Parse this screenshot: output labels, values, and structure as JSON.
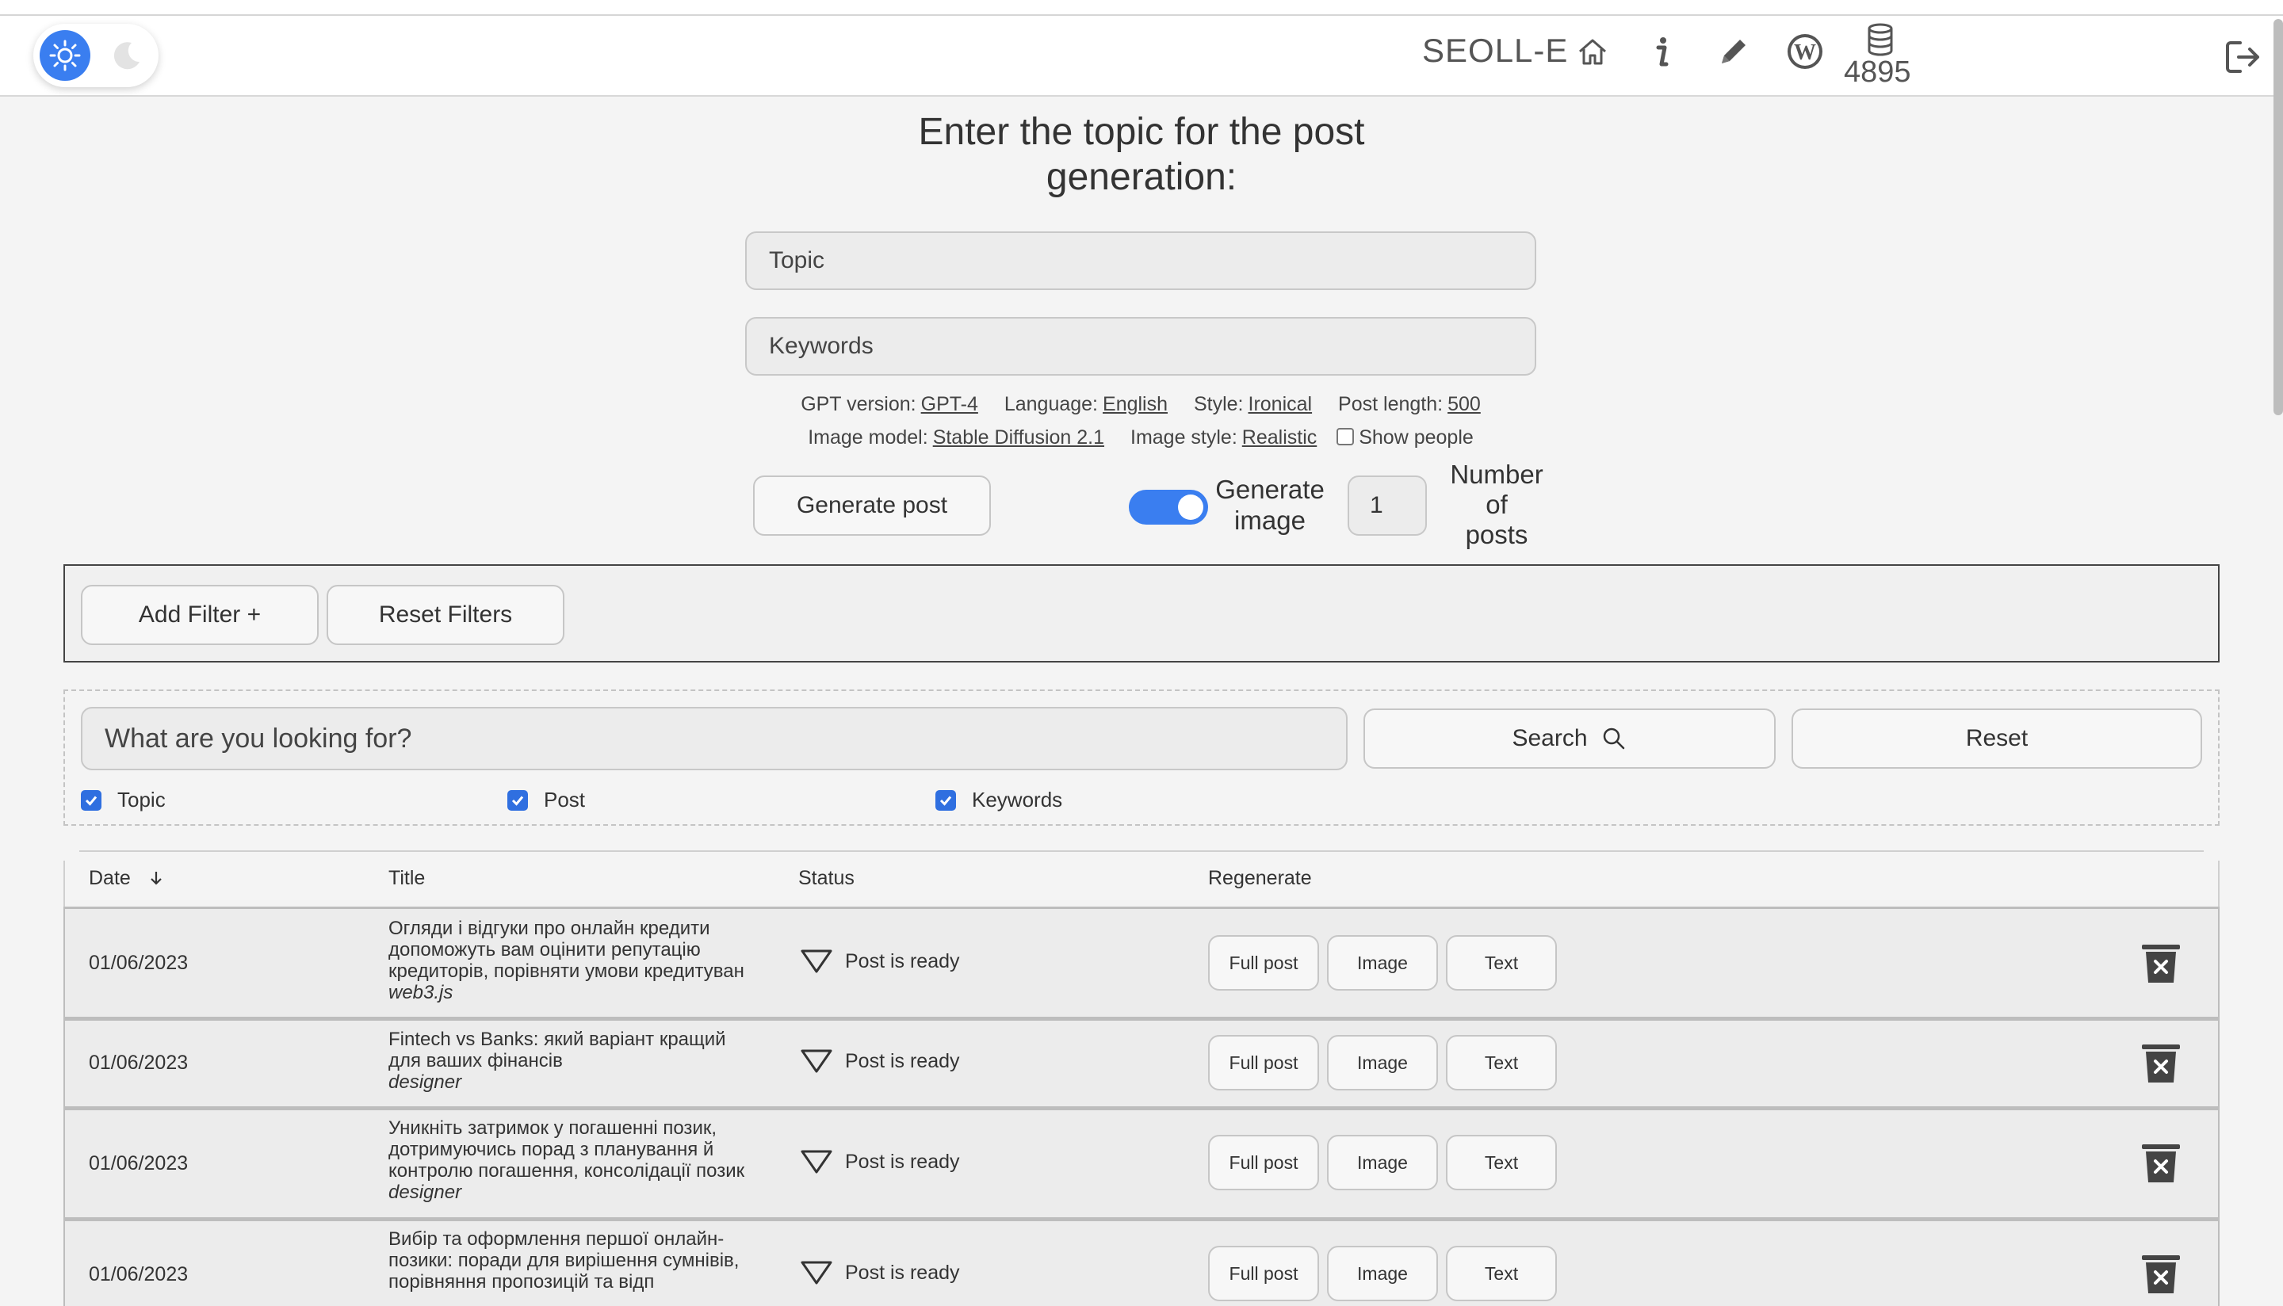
{
  "header": {
    "brand": "SEOLL-E",
    "credits": "4895",
    "search_value": "",
    "icons": [
      "sun-icon",
      "moon-icon",
      "home-icon",
      "info-icon",
      "pencil-icon",
      "wordpress-icon",
      "database-icon",
      "logout-icon"
    ]
  },
  "generator": {
    "title_line1": "Enter the topic for the post",
    "title_line2": "generation:",
    "topic_placeholder": "Topic",
    "keywords_placeholder": "Keywords",
    "settings": {
      "gpt_label": "GPT version:",
      "gpt_value": "GPT-4",
      "language_label": "Language:",
      "language_value": "English",
      "style_label": "Style:",
      "style_value": "Ironical",
      "length_label": "Post length:",
      "length_value": "500",
      "image_model_label": "Image model:",
      "image_model_value": "Stable Diffusion 2.1",
      "image_style_label": "Image style:",
      "image_style_value": "Realistic",
      "show_people_label": "Show people"
    },
    "generate_button": "Generate post",
    "generate_image_line1": "Generate",
    "generate_image_line2": "image",
    "generate_image_on": true,
    "num_posts_value": "1",
    "num_posts_line1": "Number",
    "num_posts_line2": "of",
    "num_posts_line3": "posts"
  },
  "filters": {
    "add_filter": "Add Filter +",
    "reset_filters": "Reset Filters"
  },
  "search": {
    "placeholder": "What are you looking for?",
    "search_button": "Search",
    "reset_button": "Reset",
    "checkboxes": [
      {
        "label": "Topic",
        "checked": true
      },
      {
        "label": "Post",
        "checked": true
      },
      {
        "label": "Keywords",
        "checked": true
      }
    ]
  },
  "table": {
    "headers": {
      "date": "Date",
      "title": "Title",
      "status": "Status",
      "regenerate": "Regenerate"
    },
    "sort_icon": "arrow-down-icon",
    "buttons": {
      "full": "Full post",
      "image": "Image",
      "text": "Text"
    },
    "rows": [
      {
        "date": "01/06/2023",
        "title_lines": [
          "Огляди і відгуки про онлайн кредити",
          "допоможуть вам оцінити репутацію",
          "кредиторів, порівняти умови кредитуван"
        ],
        "keyword": "web3.js",
        "status": "Post is ready"
      },
      {
        "date": "01/06/2023",
        "title_lines": [
          "Fintech vs Banks: який варіант кращий",
          "для ваших фінансів"
        ],
        "keyword": "designer",
        "status": "Post is ready"
      },
      {
        "date": "01/06/2023",
        "title_lines": [
          "Уникніть затримок у погашенні позик,",
          "дотримуючись порад з планування й",
          "контролю погашення, консолідації позик"
        ],
        "keyword": "designer",
        "status": "Post is ready"
      },
      {
        "date": "01/06/2023",
        "title_lines": [
          "Вибір та оформлення першої онлайн-",
          "позики: поради для вирішення сумнівів,",
          "порівняння пропозицій та відп"
        ],
        "keyword": "",
        "status": "Post is ready"
      }
    ]
  }
}
